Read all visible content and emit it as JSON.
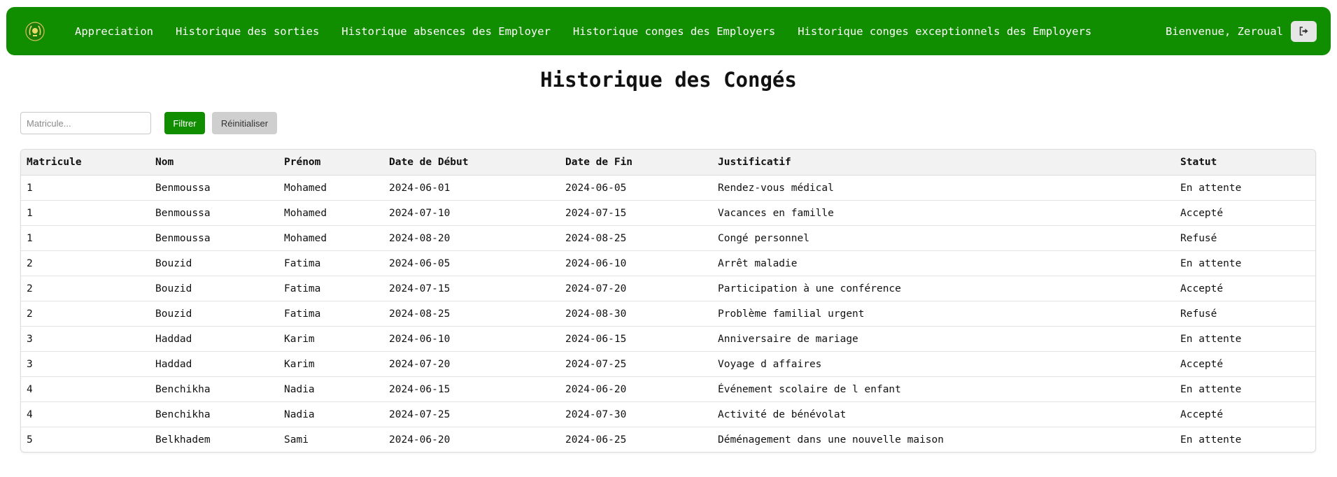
{
  "navbar": {
    "logo_icon": "emblem-icon",
    "links": [
      {
        "label": "Appreciation"
      },
      {
        "label": "Historique des sorties"
      },
      {
        "label": "Historique absences des Employer"
      },
      {
        "label": "Historique conges des Employers"
      },
      {
        "label": "Historique conges exceptionnels des Employers"
      }
    ],
    "welcome": "Bienvenue, Zeroual",
    "logout_icon": "sign-out-icon",
    "color": "#118d00"
  },
  "page": {
    "title": "Historique des Congés"
  },
  "filter": {
    "placeholder": "Matricule...",
    "value": "",
    "filter_label": "Filtrer",
    "reset_label": "Réinitialiser"
  },
  "table": {
    "headers": [
      "Matricule",
      "Nom",
      "Prénom",
      "Date de Début",
      "Date de Fin",
      "Justificatif",
      "Statut"
    ],
    "rows": [
      [
        "1",
        "Benmoussa",
        "Mohamed",
        "2024-06-01",
        "2024-06-05",
        "Rendez-vous médical",
        "En attente"
      ],
      [
        "1",
        "Benmoussa",
        "Mohamed",
        "2024-07-10",
        "2024-07-15",
        "Vacances en famille",
        "Accepté"
      ],
      [
        "1",
        "Benmoussa",
        "Mohamed",
        "2024-08-20",
        "2024-08-25",
        "Congé personnel",
        "Refusé"
      ],
      [
        "2",
        "Bouzid",
        "Fatima",
        "2024-06-05",
        "2024-06-10",
        "Arrêt maladie",
        "En attente"
      ],
      [
        "2",
        "Bouzid",
        "Fatima",
        "2024-07-15",
        "2024-07-20",
        "Participation à une conférence",
        "Accepté"
      ],
      [
        "2",
        "Bouzid",
        "Fatima",
        "2024-08-25",
        "2024-08-30",
        "Problème familial urgent",
        "Refusé"
      ],
      [
        "3",
        "Haddad",
        "Karim",
        "2024-06-10",
        "2024-06-15",
        "Anniversaire de mariage",
        "En attente"
      ],
      [
        "3",
        "Haddad",
        "Karim",
        "2024-07-20",
        "2024-07-25",
        "Voyage d affaires",
        "Accepté"
      ],
      [
        "4",
        "Benchikha",
        "Nadia",
        "2024-06-15",
        "2024-06-20",
        "Événement scolaire de l enfant",
        "En attente"
      ],
      [
        "4",
        "Benchikha",
        "Nadia",
        "2024-07-25",
        "2024-07-30",
        "Activité de bénévolat",
        "Accepté"
      ],
      [
        "5",
        "Belkhadem",
        "Sami",
        "2024-06-20",
        "2024-06-25",
        "Déménagement dans une nouvelle maison",
        "En attente"
      ]
    ]
  }
}
